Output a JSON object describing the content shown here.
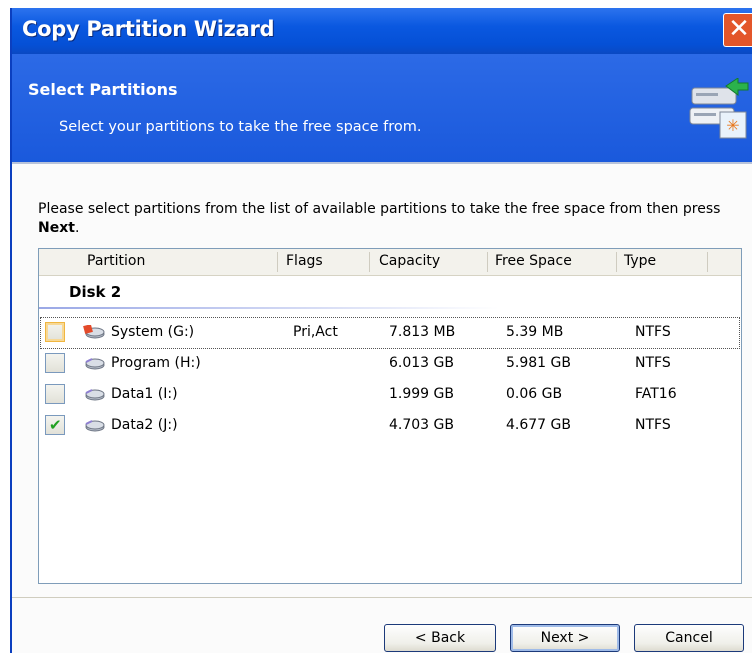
{
  "window": {
    "title": "Copy Partition Wizard",
    "close_glyph": "✕"
  },
  "header": {
    "title": "Select Partitions",
    "subtitle": "Select your partitions to take the free space from.",
    "icon": "disk-wizard-icon"
  },
  "intro": {
    "text_before": "Please select partitions from the list of available partitions to take the free space from then press ",
    "bold": "Next",
    "text_after": "."
  },
  "table": {
    "columns": [
      "Partition",
      "Flags",
      "Capacity",
      "Free Space",
      "Type"
    ],
    "group": "Disk 2",
    "rows": [
      {
        "checked": false,
        "name": "System (G:)",
        "flags": "Pri,Act",
        "capacity": "7.813 MB",
        "free": "5.39 MB",
        "type": "NTFS",
        "icon": "system-partition-icon"
      },
      {
        "checked": false,
        "name": "Program (H:)",
        "flags": "",
        "capacity": "6.013 GB",
        "free": "5.981 GB",
        "type": "NTFS",
        "icon": "partition-icon"
      },
      {
        "checked": false,
        "name": "Data1 (I:)",
        "flags": "",
        "capacity": "1.999 GB",
        "free": "0.06 GB",
        "type": "FAT16",
        "icon": "partition-icon"
      },
      {
        "checked": true,
        "name": "Data2 (J:)",
        "flags": "",
        "capacity": "4.703 GB",
        "free": "4.677 GB",
        "type": "NTFS",
        "icon": "partition-icon"
      }
    ]
  },
  "buttons": {
    "back": "< Back",
    "next": "Next >",
    "cancel": "Cancel"
  },
  "colors": {
    "title_bar": "#0a58e0",
    "close": "#e3562a",
    "check": "#21a121"
  }
}
